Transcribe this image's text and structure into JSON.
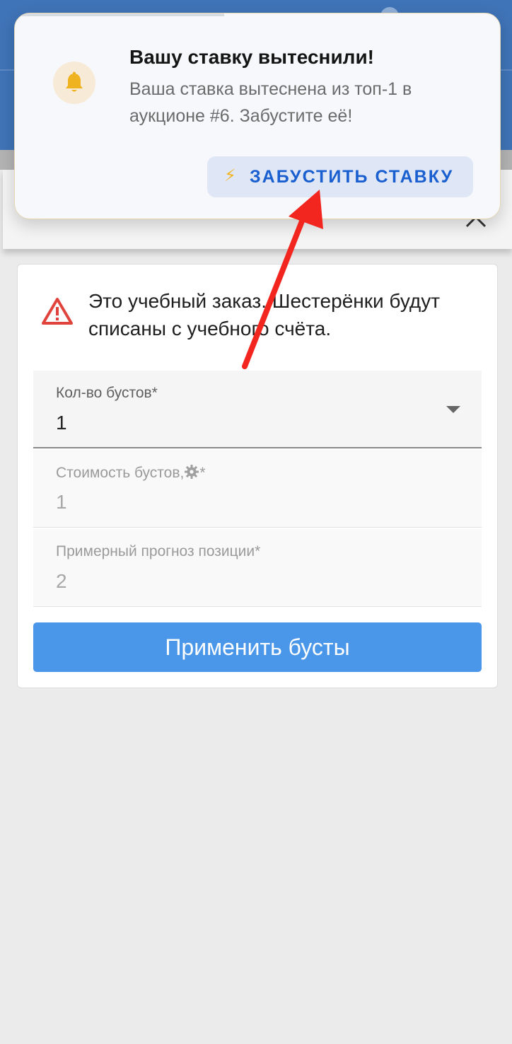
{
  "notification": {
    "title": "Вашу ставку вытеснили!",
    "message": "Ваша ставка вытеснена из топ-1 в аукционе #6. Забустите её!",
    "action_label": "ЗАБУСТИТЬ СТАВКУ",
    "action_icon": "⚡",
    "icon": "bell-icon"
  },
  "sheet": {
    "warning_text": "Это учебный заказ. Шестерёнки будут списаны с учебного счёта.",
    "fields": {
      "boost_count": {
        "label": "Кол-во бустов*",
        "value": "1"
      },
      "boost_cost": {
        "label": "Стоимость бустов,",
        "label_suffix": "*",
        "value": "1"
      },
      "position_forecast": {
        "label": "Примерный прогноз позиции*",
        "value": "2"
      }
    },
    "apply_label": "Применить бусты"
  },
  "colors": {
    "header": "#3f74b8",
    "primary_button": "#4a96e9",
    "action_text": "#1a5fd0",
    "warning": "#e0433b",
    "bell": "#f0b320",
    "annotation_arrow": "#f2261e"
  }
}
